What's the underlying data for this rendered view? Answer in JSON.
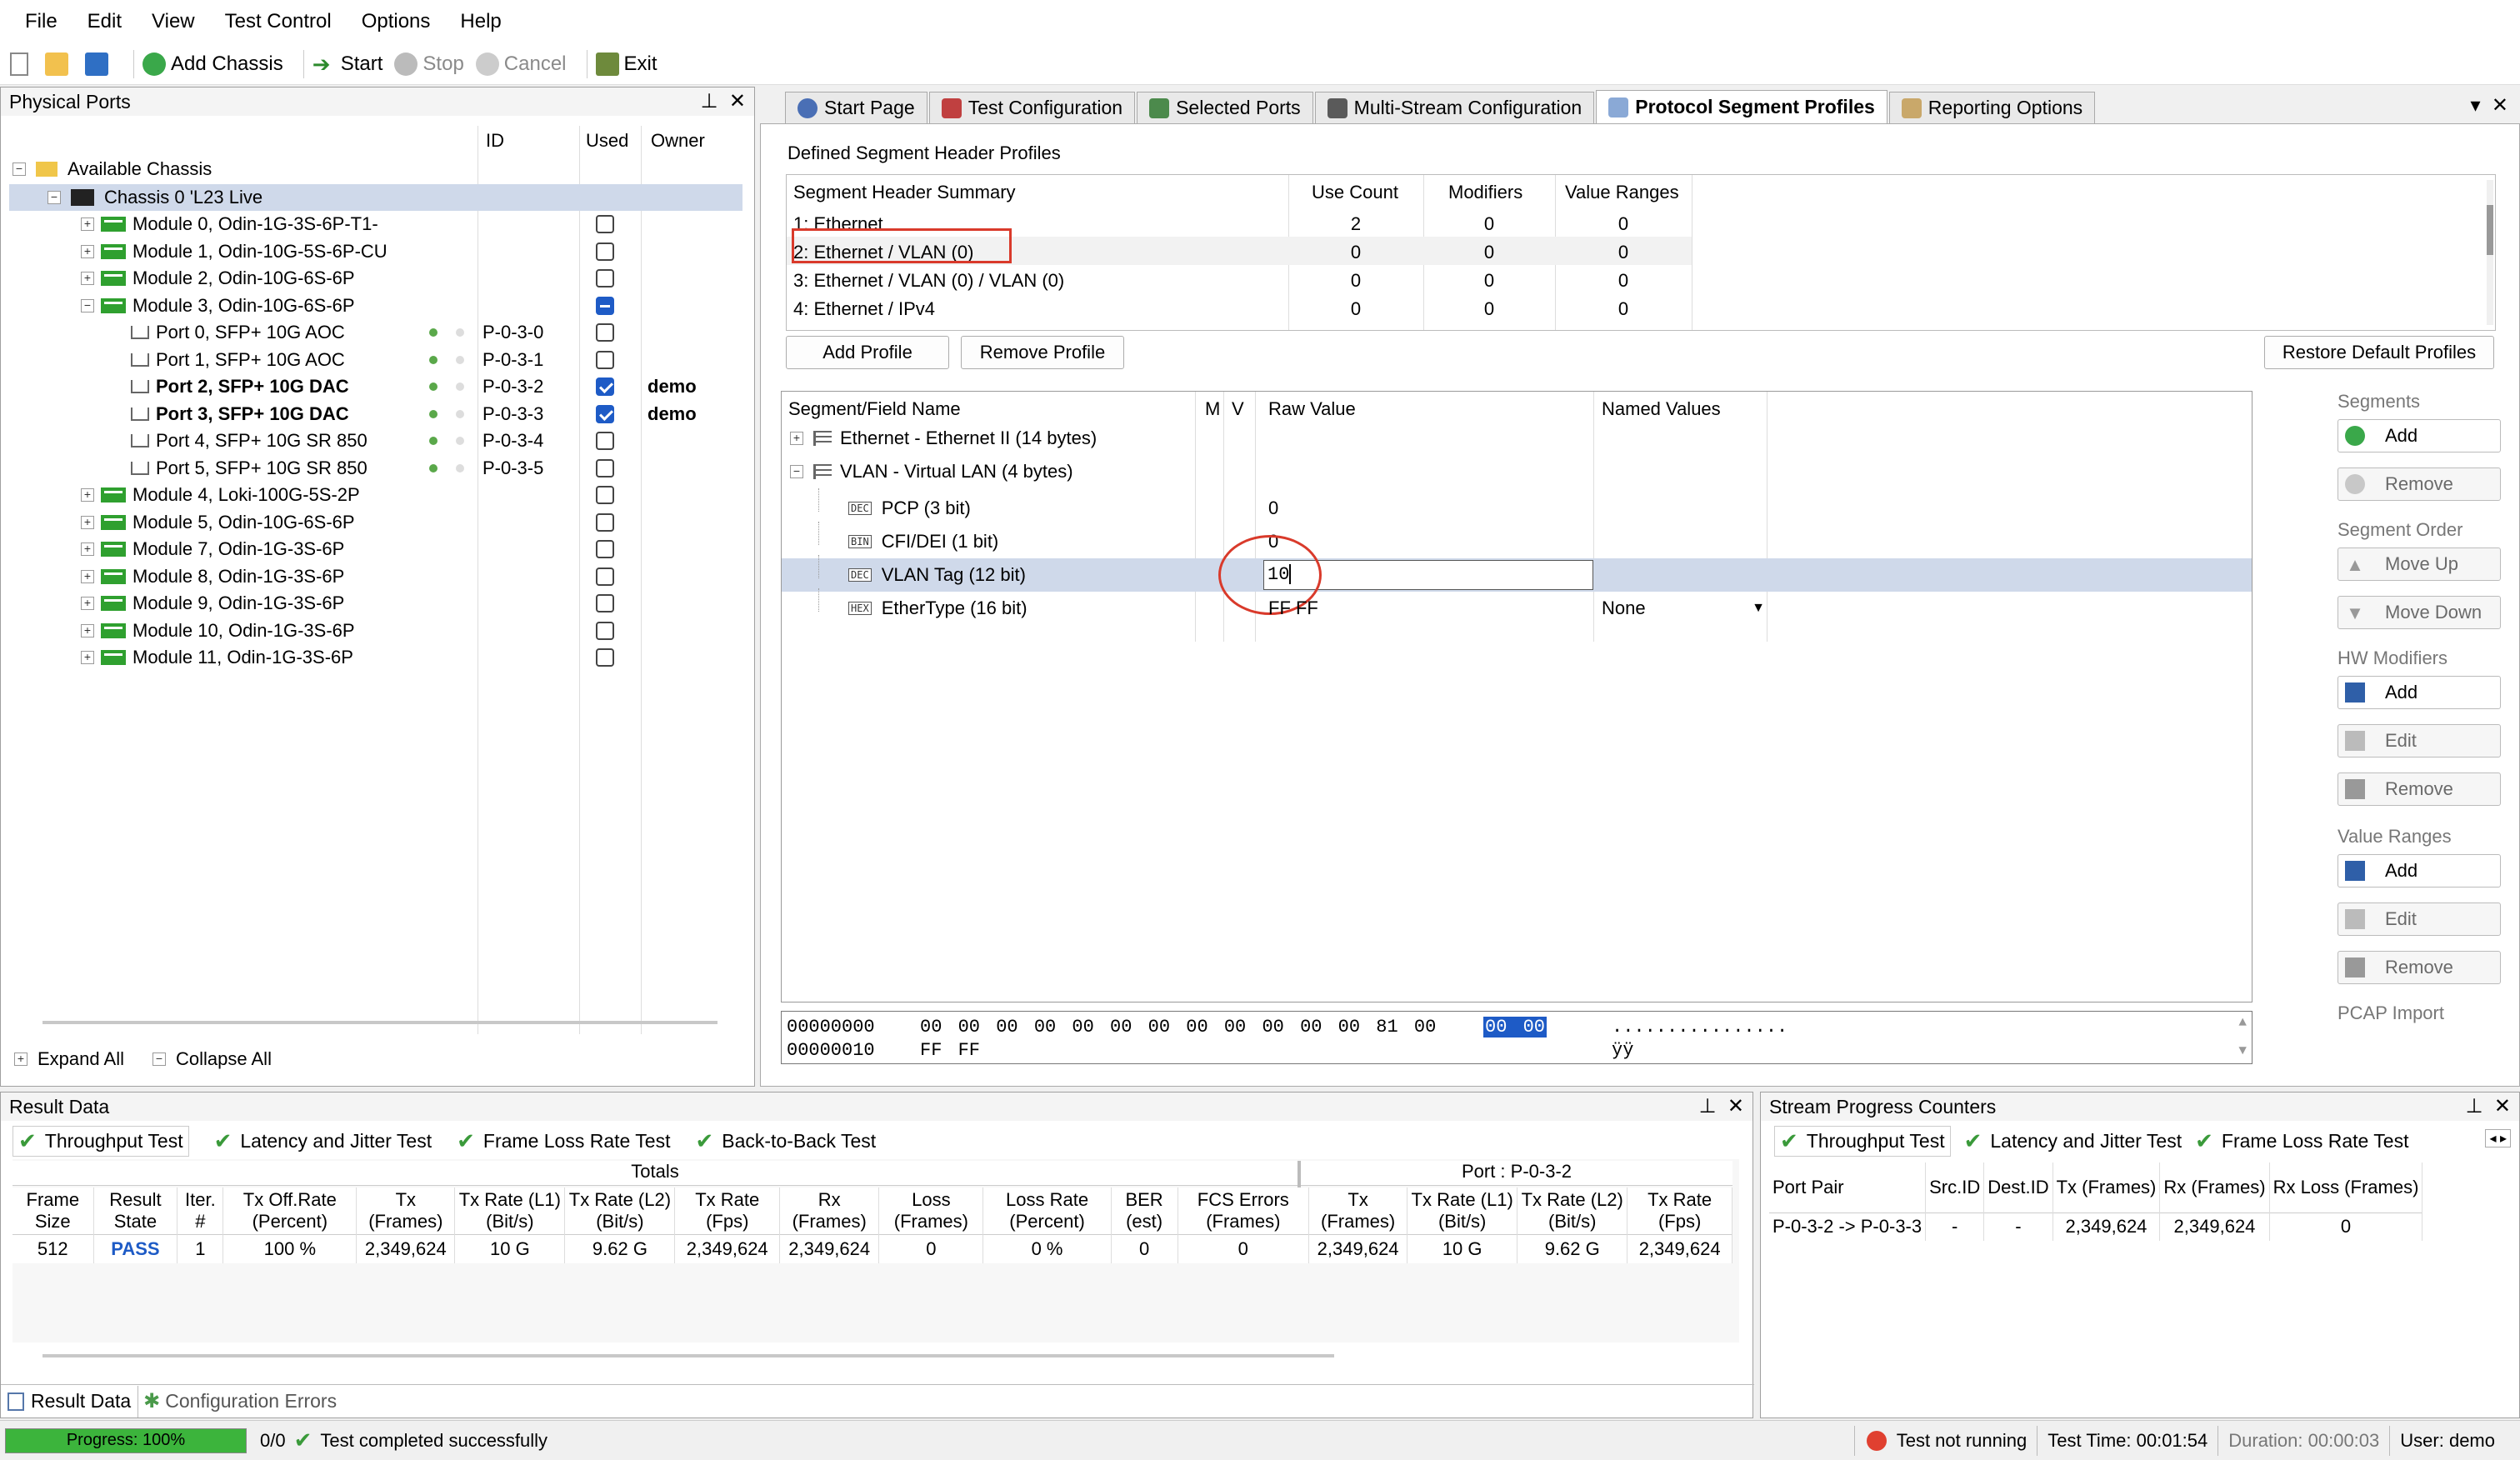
{
  "menu": [
    "File",
    "Edit",
    "View",
    "Test Control",
    "Options",
    "Help"
  ],
  "toolbar": {
    "add_chassis": "Add Chassis",
    "start": "Start",
    "stop": "Stop",
    "cancel": "Cancel",
    "exit": "Exit"
  },
  "ports_panel": {
    "title": "Physical Ports",
    "columns": {
      "id": "ID",
      "used": "Used",
      "owner": "Owner"
    },
    "root": "Available Chassis",
    "chassis": "Chassis 0 'L23 Live",
    "modules_top": [
      "Module 0, Odin-1G-3S-6P-T1-",
      "Module 1, Odin-10G-5S-6P-CU",
      "Module 2, Odin-10G-6S-6P",
      "Module 3, Odin-10G-6S-6P"
    ],
    "ports": [
      {
        "name": "Port 0, SFP+ 10G AOC",
        "id": "P-0-3-0",
        "owner": ""
      },
      {
        "name": "Port 1, SFP+ 10G AOC",
        "id": "P-0-3-1",
        "owner": ""
      },
      {
        "name": "Port 2, SFP+ 10G DAC",
        "id": "P-0-3-2",
        "owner": "demo"
      },
      {
        "name": "Port 3, SFP+ 10G DAC",
        "id": "P-0-3-3",
        "owner": "demo"
      },
      {
        "name": "Port 4, SFP+ 10G SR 850",
        "id": "P-0-3-4",
        "owner": ""
      },
      {
        "name": "Port 5, SFP+ 10G SR 850",
        "id": "P-0-3-5",
        "owner": ""
      }
    ],
    "modules_bottom": [
      "Module 4, Loki-100G-5S-2P",
      "Module 5, Odin-10G-6S-6P",
      "Module 7, Odin-1G-3S-6P",
      "Module 8, Odin-1G-3S-6P",
      "Module 9, Odin-1G-3S-6P",
      "Module 10, Odin-1G-3S-6P",
      "Module 11, Odin-1G-3S-6P"
    ],
    "expand_all": "Expand All",
    "collapse_all": "Collapse All"
  },
  "tabs": [
    "Start Page",
    "Test Configuration",
    "Selected Ports",
    "Multi-Stream Configuration",
    "Protocol Segment Profiles",
    "Reporting Options"
  ],
  "profiles": {
    "group_title": "Defined Segment Header Profiles",
    "columns": [
      "Segment Header Summary",
      "Use Count",
      "Modifiers",
      "Value Ranges"
    ],
    "rows": [
      {
        "name": "1: Ethernet",
        "use": "2",
        "mod": "0",
        "vr": "0"
      },
      {
        "name": "2: Ethernet / VLAN (0)",
        "use": "0",
        "mod": "0",
        "vr": "0"
      },
      {
        "name": "3: Ethernet / VLAN (0) / VLAN (0)",
        "use": "0",
        "mod": "0",
        "vr": "0"
      },
      {
        "name": "4: Ethernet / IPv4",
        "use": "0",
        "mod": "0",
        "vr": "0"
      }
    ],
    "add": "Add Profile",
    "remove": "Remove Profile",
    "restore": "Restore Default Profiles"
  },
  "fields": {
    "columns": [
      "Segment/Field Name",
      "M",
      "V",
      "Raw Value",
      "Named Values"
    ],
    "segments": [
      "Ethernet - Ethernet II (14 bytes)",
      "VLAN - Virtual LAN (4 bytes)"
    ],
    "rows": [
      {
        "badge": "DEC",
        "name": "PCP (3 bit)",
        "raw": "0",
        "named": ""
      },
      {
        "badge": "BIN",
        "name": "CFI/DEI (1 bit)",
        "raw": "0",
        "named": ""
      },
      {
        "badge": "DEC",
        "name": "VLAN Tag (12 bit)",
        "raw": "10",
        "named": ""
      },
      {
        "badge": "HEX",
        "name": "EtherType (16 bit)",
        "raw": "FF FF",
        "named": "None"
      }
    ]
  },
  "hex": {
    "line1_off": "00000000",
    "line1_bytes": "00 00 00 00 00 00 00 00 00 00 00 00 81 00",
    "line1_sel": "00 00",
    "line1_ascii": "................",
    "line2_off": "00000010",
    "line2_bytes": "FF FF",
    "line2_ascii": "ÿÿ"
  },
  "side": {
    "segments": "Segments",
    "add": "Add",
    "remove": "Remove",
    "order": "Segment Order",
    "up": "Move Up",
    "down": "Move Down",
    "hw": "HW Modifiers",
    "hw_add": "Add",
    "hw_edit": "Edit",
    "hw_remove": "Remove",
    "vr": "Value Ranges",
    "vr_add": "Add",
    "vr_edit": "Edit",
    "vr_remove": "Remove",
    "pcap": "PCAP Import"
  },
  "result": {
    "title": "Result Data",
    "tabs": [
      "Throughput Test",
      "Latency and Jitter Test",
      "Frame Loss Rate Test",
      "Back-to-Back Test"
    ],
    "group_totals": "Totals",
    "group_port": "Port : P-0-3-2",
    "columns": [
      "Frame Size",
      "Result State",
      "Iter. #",
      "Tx Off.Rate (Percent)",
      "Tx (Frames)",
      "Tx Rate (L1) (Bit/s)",
      "Tx Rate (L2) (Bit/s)",
      "Tx Rate (Fps)",
      "Rx (Frames)",
      "Loss (Frames)",
      "Loss Rate (Percent)",
      "BER (est)",
      "FCS Errors (Frames)",
      "Tx (Frames)",
      "Tx Rate (L1) (Bit/s)",
      "Tx Rate (L2) (Bit/s)",
      "Tx Rate (Fps)"
    ],
    "row": [
      "512",
      "PASS",
      "1",
      "100 %",
      "2,349,624",
      "10 G",
      "9.62 G",
      "2,349,624",
      "2,349,624",
      "0",
      "0 %",
      "0",
      "0",
      "2,349,624",
      "10 G",
      "9.62 G",
      "2,349,624"
    ],
    "bottom_tabs": [
      "Result Data",
      "Configuration Errors"
    ]
  },
  "stream": {
    "title": "Stream Progress Counters",
    "tabs": [
      "Throughput Test",
      "Latency and Jitter Test",
      "Frame Loss Rate Test"
    ],
    "columns": [
      "Port Pair",
      "Src.ID",
      "Dest.ID",
      "Tx (Frames)",
      "Rx (Frames)",
      "Rx Loss (Frames)"
    ],
    "row": [
      "P-0-3-2 -> P-0-3-3",
      "-",
      "-",
      "2,349,624",
      "2,349,624",
      "0"
    ]
  },
  "status": {
    "progress": "Progress: 100%",
    "progress_value": 1.0,
    "count": "0/0",
    "message": "Test completed successfully",
    "running": "Test not running",
    "time": "Test Time: 00:01:54",
    "duration": "Duration: 00:00:03",
    "user": "User: demo"
  },
  "colors": {
    "accent": "#1e5bc6",
    "highlight_border": "#d93a2b",
    "pass": "#1e5bc6",
    "progress": "#3cb43c"
  }
}
